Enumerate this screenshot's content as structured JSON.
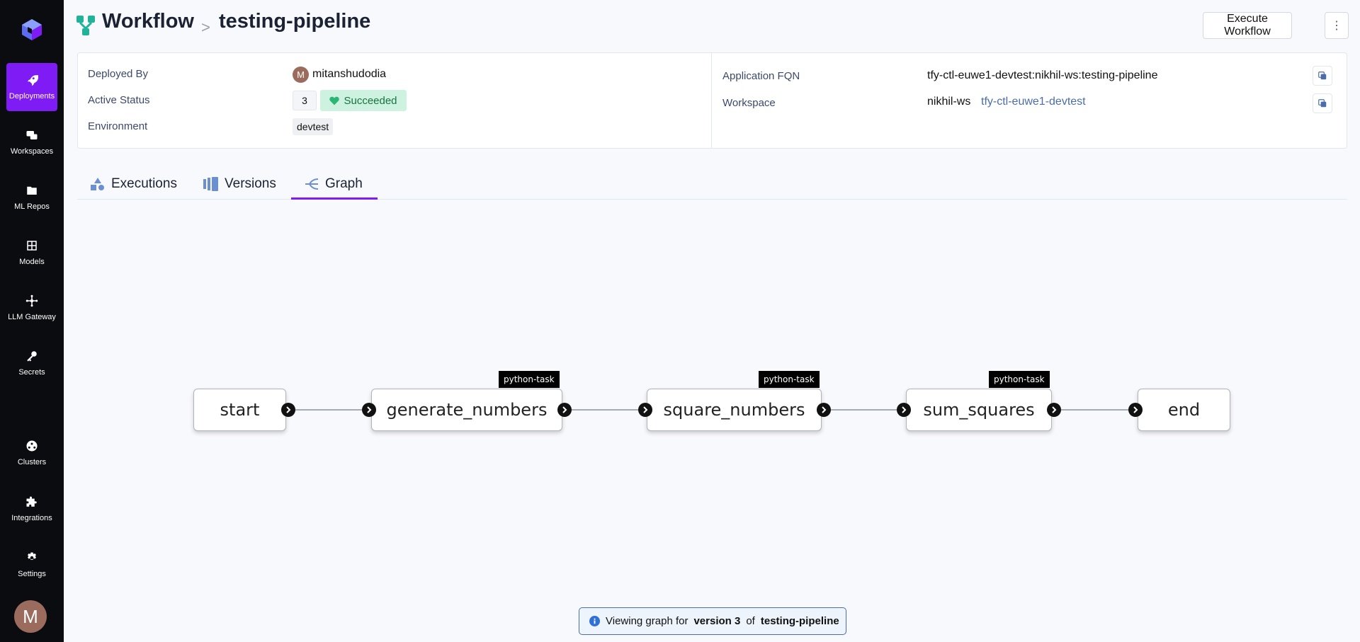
{
  "sidebar": {
    "items": [
      {
        "label": "Deployments",
        "icon": "rocket-icon"
      },
      {
        "label": "Workspaces",
        "icon": "workspaces-icon"
      },
      {
        "label": "ML Repos",
        "icon": "folder-icon"
      },
      {
        "label": "Models",
        "icon": "grid-icon"
      },
      {
        "label": "LLM Gateway",
        "icon": "network-icon"
      },
      {
        "label": "Secrets",
        "icon": "key-icon"
      },
      {
        "label": "Clusters",
        "icon": "cluster-icon"
      },
      {
        "label": "Integrations",
        "icon": "puzzle-icon"
      },
      {
        "label": "Settings",
        "icon": "gear-icon"
      }
    ],
    "avatar_initial": "M"
  },
  "header": {
    "title": "Workflow",
    "separator": ">",
    "subtitle": "testing-pipeline",
    "execute_label": "Execute Workflow",
    "more_label": "⋮"
  },
  "info": {
    "deployed_by_label": "Deployed By",
    "deployed_by_initial": "M",
    "deployed_by_value": "mitanshudodia",
    "active_status_label": "Active Status",
    "active_version": "3",
    "status_text": "Succeeded",
    "environment_label": "Environment",
    "environment_value": "devtest",
    "fqn_label": "Application FQN",
    "fqn_value": "tfy-ctl-euwe1-devtest:nikhil-ws:testing-pipeline",
    "workspace_label": "Workspace",
    "workspace_value": "nikhil-ws",
    "workspace_cluster": "tfy-ctl-euwe1-devtest"
  },
  "tabs": [
    {
      "label": "Executions",
      "icon": "executions-icon"
    },
    {
      "label": "Versions",
      "icon": "versions-icon"
    },
    {
      "label": "Graph",
      "icon": "graph-icon",
      "active": true
    }
  ],
  "graph": {
    "nodes": [
      {
        "label": "start",
        "tag": ""
      },
      {
        "label": "generate_numbers",
        "tag": "python-task"
      },
      {
        "label": "square_numbers",
        "tag": "python-task"
      },
      {
        "label": "sum_squares",
        "tag": "python-task"
      },
      {
        "label": "end",
        "tag": ""
      }
    ]
  },
  "banner": {
    "prefix": "Viewing graph for",
    "version": "version 3",
    "middle": "of",
    "name": "testing-pipeline"
  },
  "colors": {
    "accent": "#7f1bf5",
    "sidebar_bg": "#0a0c10",
    "success_bg": "#cdf3e0",
    "success_text": "#17733f",
    "link": "#4b6da8"
  }
}
